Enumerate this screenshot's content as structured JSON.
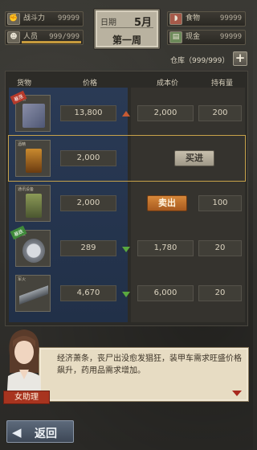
{
  "stats": {
    "combat": {
      "label": "战斗力",
      "value": "99999",
      "icon": "fist-icon"
    },
    "people": {
      "label": "人员",
      "value": "999/999",
      "icon": "person-icon",
      "fill": 1.0
    },
    "food": {
      "label": "食物",
      "value": "99999",
      "icon": "meat-icon"
    },
    "cash": {
      "label": "现金",
      "value": "99999",
      "icon": "money-icon"
    }
  },
  "date": {
    "label": "日期",
    "month": "5月",
    "week": "第一周"
  },
  "warehouse": {
    "label": "仓库（999/999）",
    "add": "+"
  },
  "table": {
    "headers": {
      "goods": "货物",
      "price": "价格",
      "cost": "成本价",
      "hold": "持有量"
    },
    "rows": [
      {
        "name": "书籍",
        "badge": "暴涨",
        "price": "13,800",
        "trend": "up",
        "cost": "2,000",
        "hold": "200",
        "action": ""
      },
      {
        "name": "酒精",
        "badge": "",
        "price": "2,000",
        "trend": "",
        "cost": "",
        "hold": "",
        "action": "buy"
      },
      {
        "name": "通讯设备",
        "badge": "",
        "price": "2,000",
        "trend": "",
        "cost": "",
        "hold": "100",
        "action": "sell"
      },
      {
        "name": "手表",
        "badge": "暴跌",
        "price": "289",
        "trend": "down",
        "cost": "1,780",
        "hold": "20",
        "action": ""
      },
      {
        "name": "军火",
        "badge": "",
        "price": "4,670",
        "trend": "down",
        "cost": "6,000",
        "hold": "20",
        "action": ""
      }
    ],
    "buy_label": "买进",
    "sell_label": "卖出"
  },
  "dialog": {
    "speaker": "女助理",
    "text": "经济萧条，丧尸出没愈发猖狂，装甲车需求旺盛价格飙升，药用品需求增加。"
  },
  "back": {
    "label": "返回"
  }
}
